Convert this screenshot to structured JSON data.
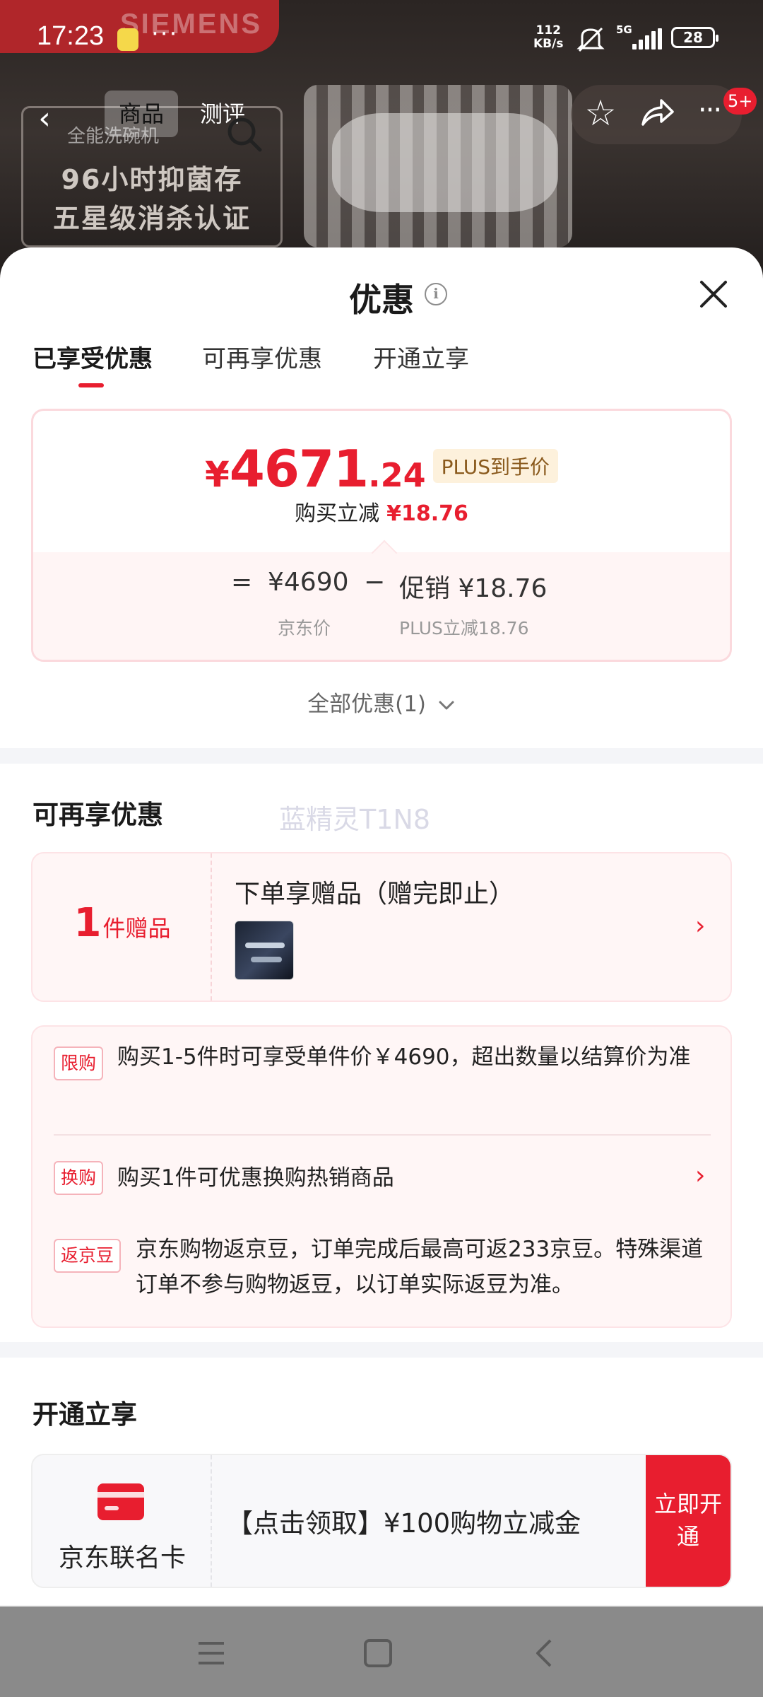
{
  "status_bar": {
    "time": "17:23",
    "dots": "···",
    "speed_value": "112",
    "speed_unit": "KB/s",
    "network": "5G",
    "battery": "28"
  },
  "background": {
    "brand": "SIEMENS",
    "search_hint": "全能洗碗机",
    "promo_line1": "96小时抑菌存",
    "promo_line2": "五星级消杀认证"
  },
  "nav": {
    "tab_product": "商品",
    "tab_review": "测评",
    "more_badge": "5+"
  },
  "sheet": {
    "title": "优惠",
    "tabs": [
      "已享受优惠",
      "可再享优惠",
      "开通立享"
    ],
    "price": {
      "yen": "¥",
      "integer": "4671",
      "decimal": ".24",
      "tag": "PLUS到手价",
      "sub_label": "购买立减",
      "sub_value": "¥18.76"
    },
    "calc": {
      "equals": "=",
      "jd_price": "¥4690",
      "minus": "−",
      "promo": "促销 ¥18.76",
      "jd_price_label": "京东价",
      "promo_label": "PLUS立减18.76"
    },
    "all_deals": "全部优惠(1)",
    "more_section": {
      "title": "可再享优惠",
      "watermark": "蓝精灵T1N8",
      "gift": {
        "count": "1",
        "unit": "件赠品",
        "title": "下单享赠品（赠完即止）"
      },
      "promos": [
        {
          "tag": "限购",
          "text": "购买1-5件时可享受单件价￥4690，超出数量以结算价为准"
        },
        {
          "tag": "换购",
          "text": "购买1件可优惠换购热销商品"
        },
        {
          "tag": "返京豆",
          "text": "京东购物返京豆，订单完成后最高可返233京豆。特殊渠道订单不参与购物返豆，以订单实际返豆为准。"
        }
      ]
    },
    "open_section": {
      "title": "开通立享",
      "card_name": "京东联名卡",
      "offer": "【点击领取】¥100购物立减金",
      "button": "立即开通"
    }
  },
  "colors": {
    "accent": "#e81e2f",
    "gold_tag_bg": "#fdf1dc",
    "gold_tag_text": "#8a5a1d"
  }
}
